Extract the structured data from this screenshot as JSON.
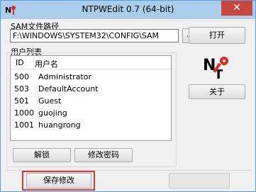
{
  "window": {
    "title": "NTPWEdit 0.7 (64-bit)",
    "close_glyph": "✕"
  },
  "sam": {
    "label": "SAM文件路径",
    "path": "F:\\WINDOWS\\SYSTEM32\\CONFIG\\SAM",
    "browse_label": "...",
    "open_label": "打开"
  },
  "users": {
    "label": "用户列表",
    "columns": {
      "id": "ID",
      "name": "用户名"
    },
    "rows": [
      {
        "id": "500",
        "name": "Administrator"
      },
      {
        "id": "503",
        "name": "DefaultAccount"
      },
      {
        "id": "501",
        "name": "Guest"
      },
      {
        "id": "1000",
        "name": "guojing"
      },
      {
        "id": "1001",
        "name": "huangrong"
      }
    ],
    "unlock_label": "解锁",
    "change_password_label": "修改密码"
  },
  "side": {
    "logo_icon": "ntpwedit-logo-icon",
    "about_label": "关于"
  },
  "footer": {
    "save_label": "保存修改",
    "exit_label": ""
  },
  "colors": {
    "titlebar": "#a9cdeb",
    "close": "#c7463e",
    "highlight": "#e8352e",
    "logo_red": "#e0281e"
  }
}
